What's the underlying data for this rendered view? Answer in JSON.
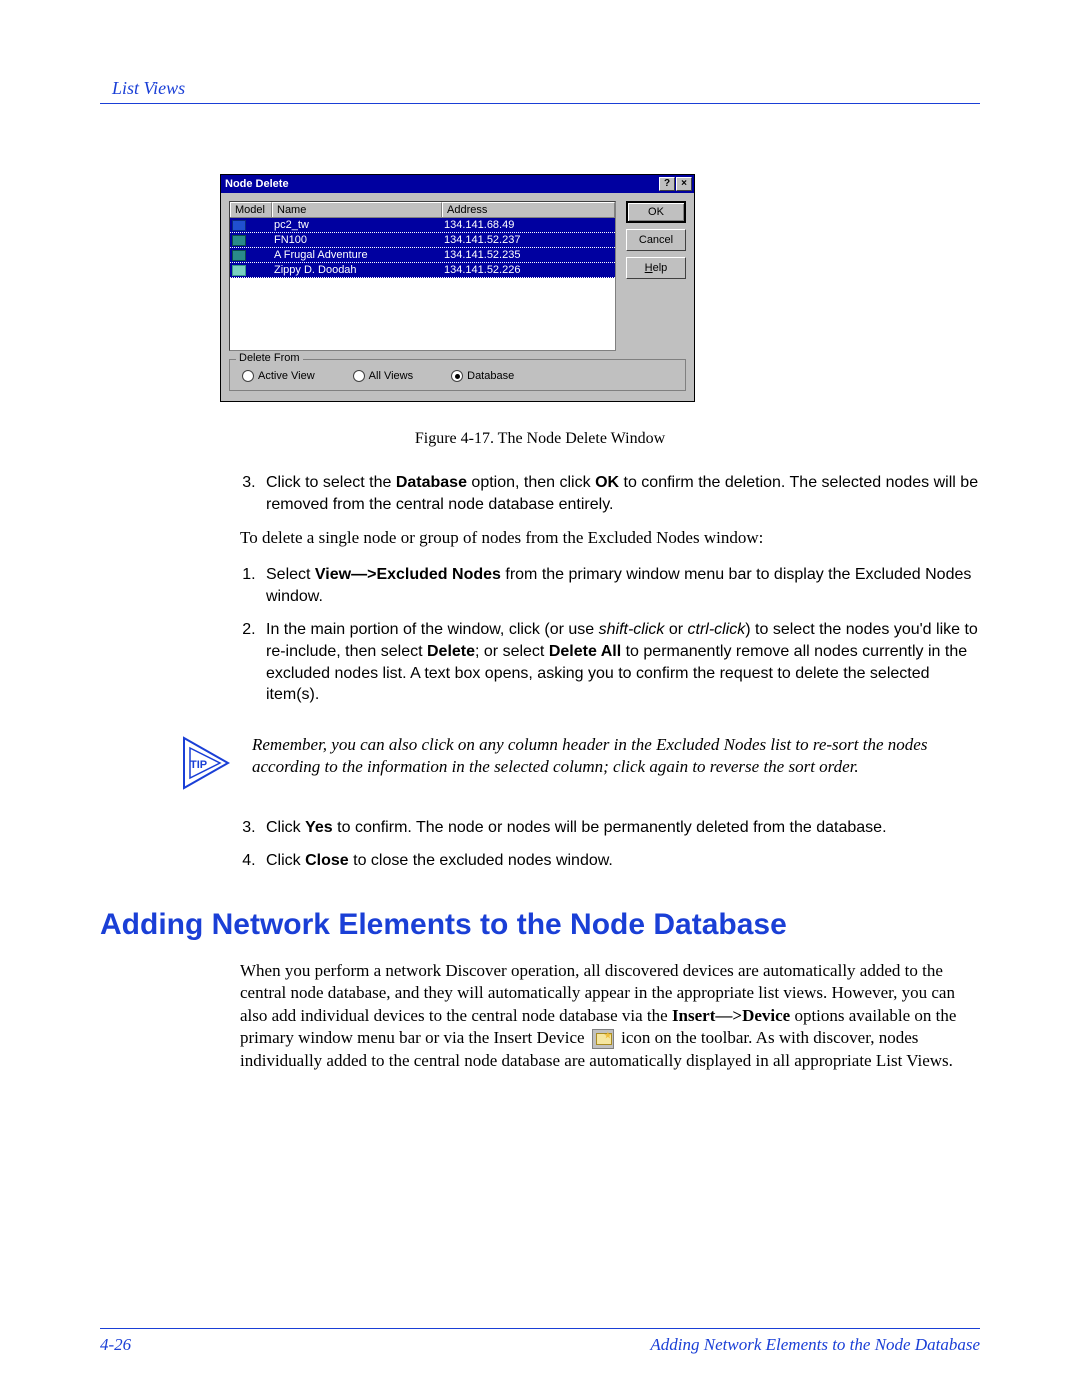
{
  "header": {
    "section": "List Views"
  },
  "dialog": {
    "title": "Node Delete",
    "help_btn": "?",
    "close_btn": "×",
    "columns": {
      "model": "Model",
      "name": "Name",
      "address": "Address"
    },
    "rows": [
      {
        "name": "pc2_tw",
        "address": "134.141.68.49",
        "iconClass": "blue"
      },
      {
        "name": "FN100",
        "address": "134.141.52.237",
        "iconClass": ""
      },
      {
        "name": "A Frugal Adventure",
        "address": "134.141.52.235",
        "iconClass": ""
      },
      {
        "name": "Zippy D. Doodah",
        "address": "134.141.52.226",
        "iconClass": "lt"
      }
    ],
    "buttons": {
      "ok": "OK",
      "cancel": "Cancel",
      "help": "Help",
      "help_ul": "H"
    },
    "delete_from": {
      "legend": "Delete From",
      "opts": {
        "active_view": "Active View",
        "active_ul": "A",
        "all_views": "All Views",
        "all_ul": "V",
        "database": "Database",
        "db_ul": "D"
      }
    }
  },
  "figure_caption": "Figure 4-17. The Node Delete Window",
  "step3a_pre": "Click to select the ",
  "step3a_bold1": "Database",
  "step3a_mid": " option, then click ",
  "step3a_bold2": "OK",
  "step3a_post": " to confirm the deletion. The selected nodes will be removed from the central node database entirely.",
  "intro_excluded": "To delete a single node or group of nodes from the Excluded Nodes window:",
  "step1_pre": "Select ",
  "step1_bold": "View—>Excluded Nodes",
  "step1_post": " from the primary window menu bar to display the Excluded Nodes window.",
  "step2_pre": "In the main portion of the window, click (or use ",
  "step2_it1": "shift-click",
  "step2_mid1": " or ",
  "step2_it2": "ctrl-click",
  "step2_mid2": ") to select the nodes you'd like to re-include, then select ",
  "step2_bold1": "Delete",
  "step2_mid3": "; or select ",
  "step2_bold2": "Delete All",
  "step2_post": " to permanently remove all nodes currently in the excluded nodes list. A text box opens, asking you to confirm the request to delete the selected item(s).",
  "tip_label": "TIP",
  "tip_text": "Remember, you can also click on any column header in the Excluded Nodes list to re-sort the nodes according to the information in the selected column; click again to reverse the sort order.",
  "step3b_pre": "Click ",
  "step3b_bold": "Yes",
  "step3b_post": " to confirm. The node or nodes will be permanently deleted from the database.",
  "step4_pre": "Click ",
  "step4_bold": "Close",
  "step4_post": " to close the excluded nodes window.",
  "section_heading": "Adding Network Elements to the Node Database",
  "para2_a": "When you perform a network Discover operation, all discovered devices are automatically added to the central node database, and they will automatically appear in the appropriate list views. However, you can also add individual devices to the central node database via the ",
  "para2_bold": "Insert—>Device",
  "para2_b": " options available on the primary window menu bar or via the Insert Device ",
  "para2_c": " icon on the toolbar. As with discover, nodes individually added to the central node database are automatically displayed in all appropriate List Views.",
  "footer": {
    "page": "4-26",
    "title": "Adding Network Elements to the Node Database"
  }
}
